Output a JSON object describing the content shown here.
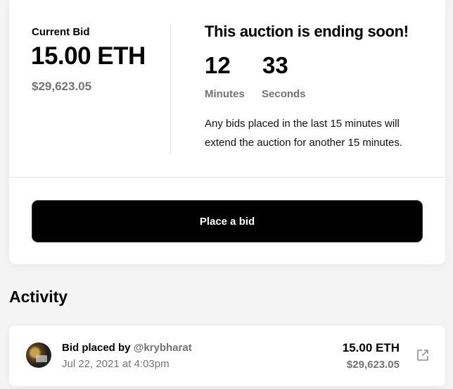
{
  "auction": {
    "current_bid_label": "Current Bid",
    "current_bid_eth": "15.00 ETH",
    "current_bid_usd": "$29,623.05",
    "ending_title": "This auction is ending soon!",
    "minutes_value": "12",
    "minutes_label": "Minutes",
    "seconds_value": "33",
    "seconds_label": "Seconds",
    "note": "Any bids placed in the last 15 minutes will extend the auction for another 15 minutes.",
    "place_bid_label": "Place a bid"
  },
  "activity": {
    "title": "Activity",
    "items": [
      {
        "bid_prefix": "Bid placed by",
        "handle": "@krybharat",
        "date": "Jul 22, 2021 at 4:03pm",
        "eth": "15.00 ETH",
        "usd": "$29,623.05",
        "avatar_icon": "user-avatar",
        "link_icon": "external-link-icon"
      }
    ]
  },
  "colors": {
    "muted_text": "#737373",
    "button_bg": "#000000",
    "background": "#f4f4f4"
  }
}
